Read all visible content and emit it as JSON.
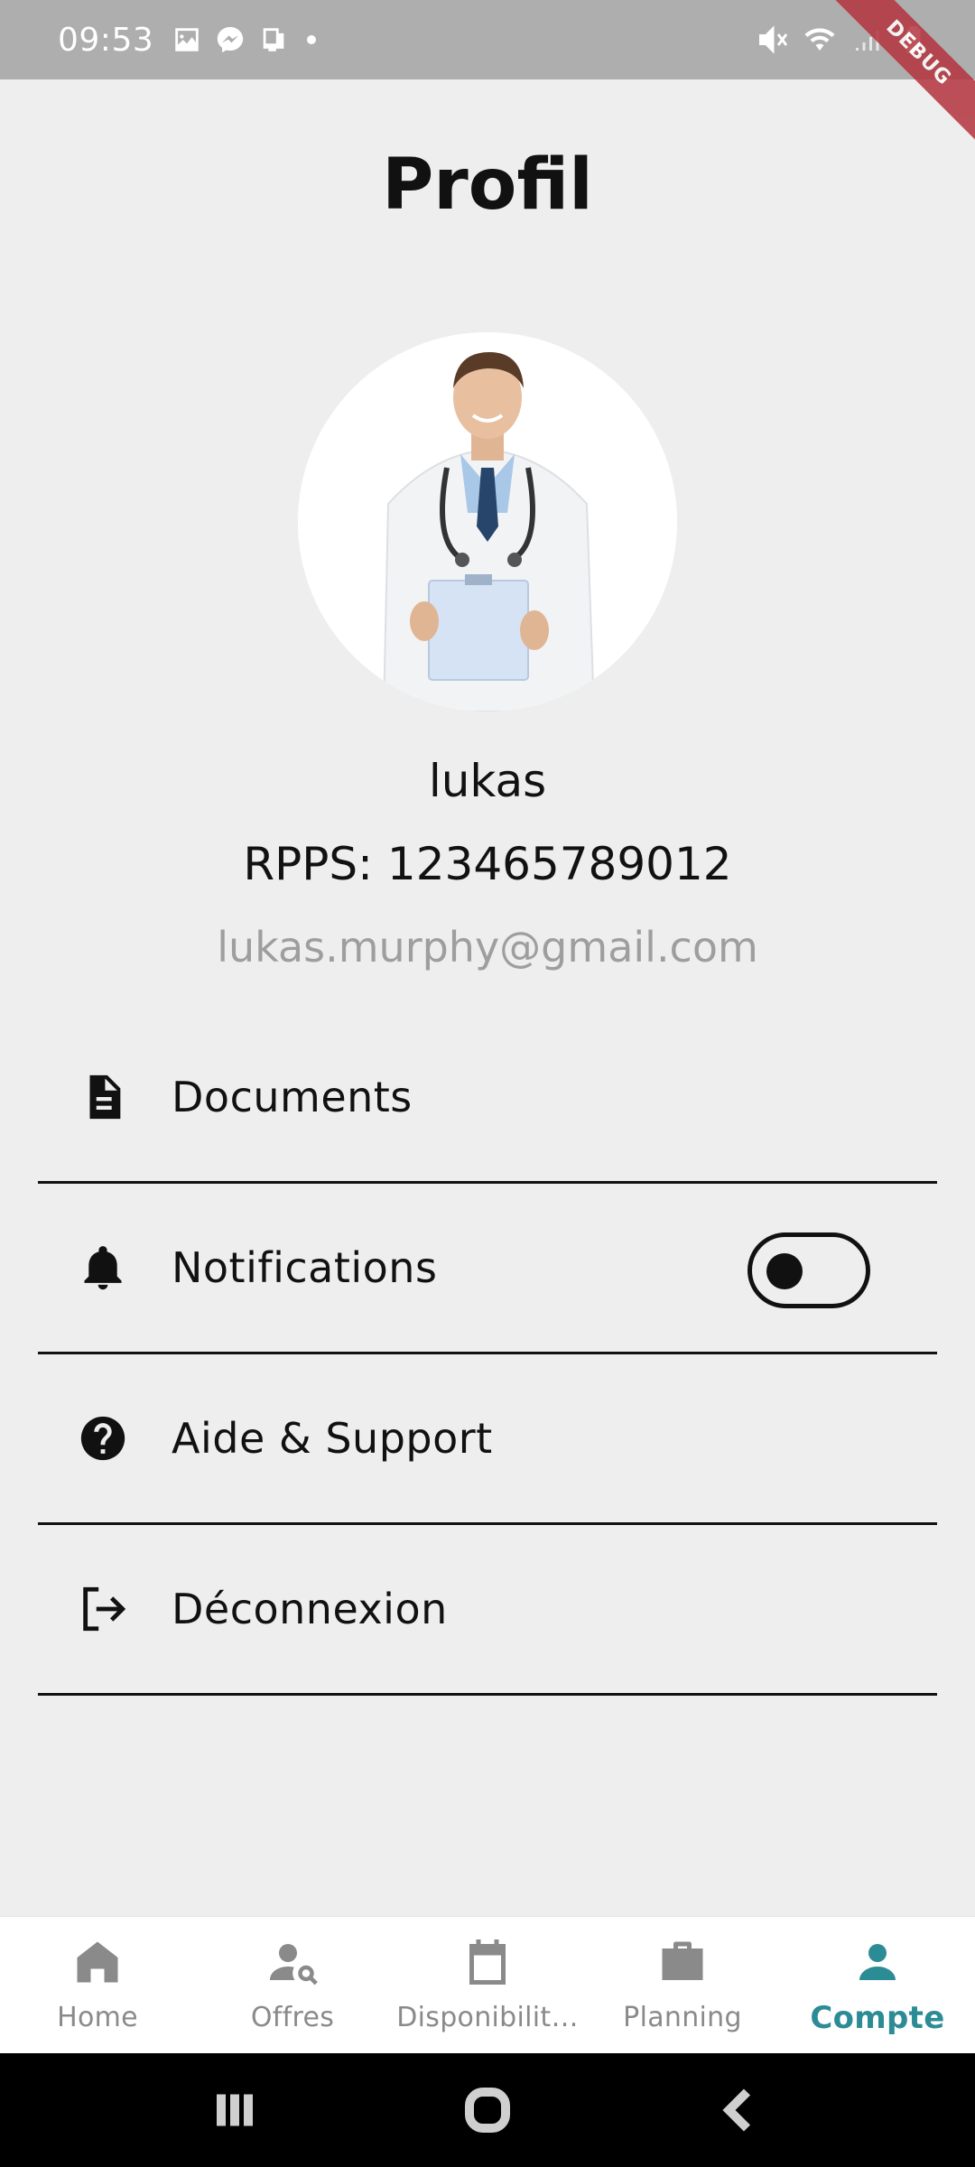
{
  "status_bar": {
    "time": "09:53",
    "left_icons": [
      "image-icon",
      "messenger-icon",
      "device-icon"
    ],
    "right_icons": [
      "mute-icon",
      "wifi-icon",
      "signal-icon",
      "battery-icon"
    ]
  },
  "debug_banner": "DEBUG",
  "header": {
    "title": "Profil"
  },
  "profile": {
    "name": "lukas",
    "rpps": "RPPS: 123465789012",
    "email": "lukas.murphy@gmail.com"
  },
  "menu": {
    "items": [
      {
        "label": "Documents",
        "icon": "document-icon"
      },
      {
        "label": "Notifications",
        "icon": "bell-icon",
        "toggle_on": false
      },
      {
        "label": "Aide & Support",
        "icon": "help-icon"
      },
      {
        "label": "Déconnexion",
        "icon": "logout-icon"
      }
    ]
  },
  "bottom_nav": {
    "items": [
      {
        "label": "Home",
        "icon": "home-icon"
      },
      {
        "label": "Offres",
        "icon": "person-search-icon"
      },
      {
        "label": "Disponibilit…",
        "icon": "calendar-icon"
      },
      {
        "label": "Planning",
        "icon": "briefcase-icon"
      },
      {
        "label": "Compte",
        "icon": "person-icon",
        "active": true
      }
    ],
    "active_color": "#2c8c96",
    "inactive_color": "#8a8a8a"
  },
  "system_nav": [
    "recents-icon",
    "home-circle-icon",
    "back-icon"
  ]
}
